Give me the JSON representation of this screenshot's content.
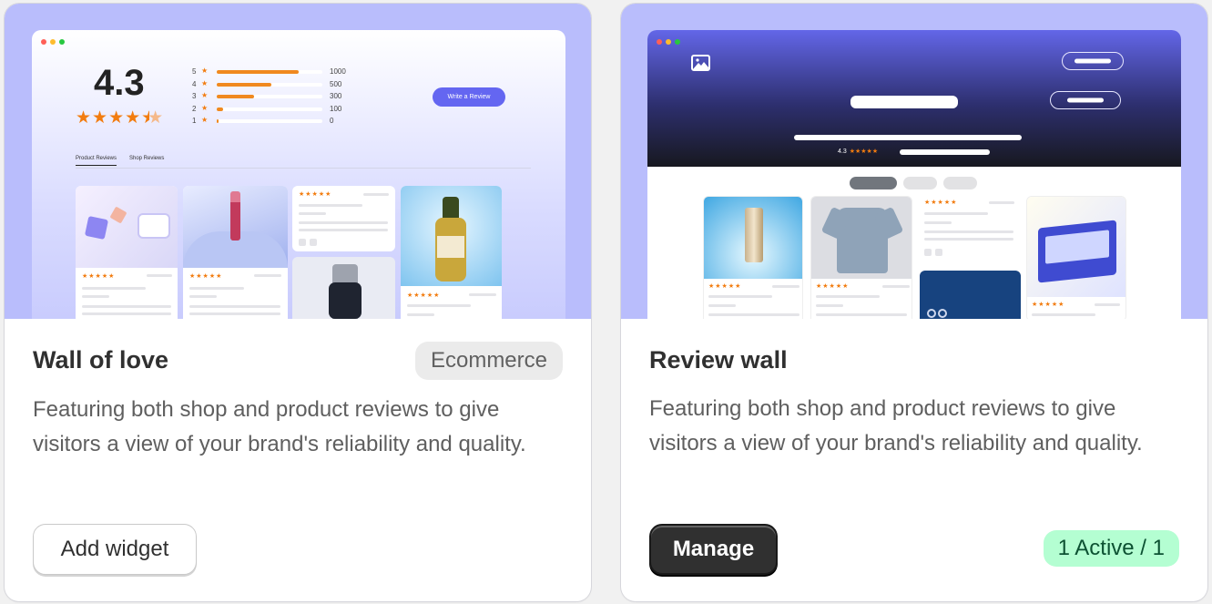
{
  "cards": [
    {
      "title": "Wall of love",
      "tag": "Ecommerce",
      "description": "Featuring both shop and product reviews to give visitors a view of your brand's reliability and quality.",
      "button_label": "Add widget",
      "preview": {
        "average_rating": "4.3",
        "rating_distribution": [
          {
            "stars": "5",
            "count": "1000",
            "fraction": 0.78
          },
          {
            "stars": "4",
            "count": "500",
            "fraction": 0.52
          },
          {
            "stars": "3",
            "count": "300",
            "fraction": 0.35
          },
          {
            "stars": "2",
            "count": "100",
            "fraction": 0.06
          },
          {
            "stars": "1",
            "count": "0",
            "fraction": 0.02
          }
        ],
        "write_review_label": "Write a Review",
        "tabs": [
          "Product Reviews",
          "Shop Reviews"
        ],
        "stars_text": "★★★★★"
      }
    },
    {
      "title": "Review wall",
      "description": "Featuring both shop and product reviews to give visitors a view of your brand's reliability and quality.",
      "button_label": "Manage",
      "status": "1 Active / 1",
      "preview": {
        "rating": "4.3",
        "stars_text": "★★★★★"
      }
    }
  ],
  "colors": {
    "preview_bg": "#b9bdfc",
    "accent": "#6466f1",
    "star": "#f27c0f",
    "status_bg": "#b4fed2",
    "status_text": "#0c5132",
    "primary_button": "#303030"
  },
  "icons": [
    "image-icon",
    "star-icon"
  ]
}
